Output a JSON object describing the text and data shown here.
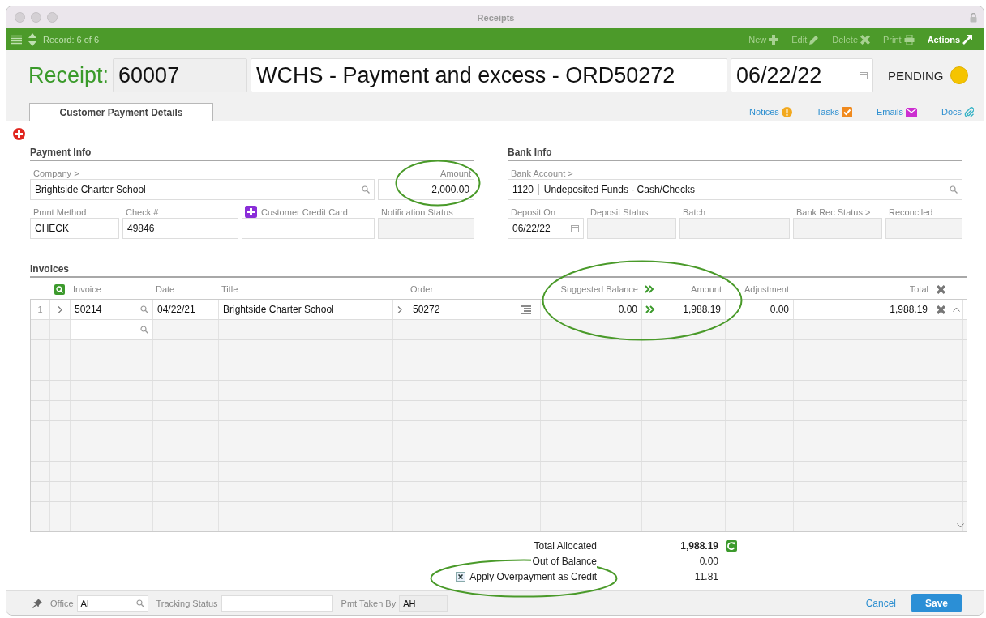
{
  "window": {
    "title": "Receipts"
  },
  "toolbar": {
    "record": "Record: 6 of 6",
    "actions": [
      {
        "label": "New",
        "kind": "new",
        "disabled": true
      },
      {
        "label": "Edit",
        "kind": "edit",
        "disabled": true
      },
      {
        "label": "Delete",
        "kind": "delete",
        "disabled": true
      },
      {
        "label": "Print",
        "kind": "print",
        "disabled": true
      },
      {
        "label": "Actions",
        "kind": "actions",
        "disabled": false
      }
    ]
  },
  "header": {
    "label": "Receipt:",
    "number": "60007",
    "title": "WCHS - Payment and excess - ORD50272",
    "date": "06/22/22",
    "status": "PENDING"
  },
  "tabs": [
    {
      "label": "Customer Payment Details",
      "selected": true
    }
  ],
  "links": [
    {
      "label": "Notices",
      "kind": "notices"
    },
    {
      "label": "Tasks",
      "kind": "tasks"
    },
    {
      "label": "Emails",
      "kind": "emails"
    },
    {
      "label": "Docs",
      "kind": "docs"
    }
  ],
  "sections": [
    {
      "title": "Payment Info",
      "rows": [
        [
          {
            "label": "Company >",
            "value": "Brightside Charter School",
            "kind": "search"
          },
          {
            "label": "Amount",
            "value": "2,000.00",
            "kind": "amount"
          }
        ],
        [
          {
            "label": "Pmnt Method",
            "value": "CHECK",
            "kind": "text"
          },
          {
            "label": "Check #",
            "value": "49846",
            "kind": "text"
          },
          {
            "label": "Customer Credit Card",
            "kind": "add"
          },
          {
            "label": "Notification Status",
            "kind": "readonly"
          }
        ]
      ]
    },
    {
      "title": "Bank Info",
      "rows": [
        [
          {
            "label": "Bank Account >",
            "code": "1120",
            "value": "Undeposited Funds - Cash/Checks",
            "kind": "account"
          }
        ],
        [
          {
            "label": "Deposit On",
            "value": "06/22/22",
            "kind": "date"
          },
          {
            "label": "Deposit Status",
            "kind": "readonly"
          },
          {
            "label": "Batch",
            "kind": "readonly"
          },
          {
            "label": "Bank Rec Status >",
            "kind": "readonly"
          },
          {
            "label": "Reconciled",
            "kind": "readonly"
          }
        ]
      ]
    }
  ],
  "invoices": {
    "title": "Invoices",
    "columns": [
      "Invoice",
      "Date",
      "Title",
      "Order",
      "Suggested Balance",
      "Amount",
      "Adjustment",
      "Total"
    ],
    "rows": [
      {
        "line": "1",
        "invoice": "50214",
        "date": "04/22/21",
        "title": "Brightside Charter School",
        "order": "50272",
        "suggested_balance": "0.00",
        "amount": "1,988.19",
        "adjustment": "0.00",
        "total": "1,988.19"
      }
    ]
  },
  "totals": [
    {
      "label": "Total Allocated",
      "value": "1,988.19",
      "kind": "total"
    },
    {
      "label": "Out of Balance",
      "value": "0.00",
      "kind": "plain"
    },
    {
      "label": "Apply Overpayment as Credit",
      "value": "11.81",
      "kind": "checkbox",
      "checked": true
    }
  ],
  "footer": {
    "fields": [
      {
        "label": "Office",
        "value": "AI",
        "kind": "search"
      },
      {
        "label": "Tracking Status",
        "kind": "text"
      },
      {
        "label": "Pmt Taken By",
        "value": "AH",
        "kind": "readonly"
      }
    ],
    "buttons": [
      {
        "label": "Cancel",
        "kind": "link"
      },
      {
        "label": "Save",
        "kind": "primary"
      }
    ]
  }
}
